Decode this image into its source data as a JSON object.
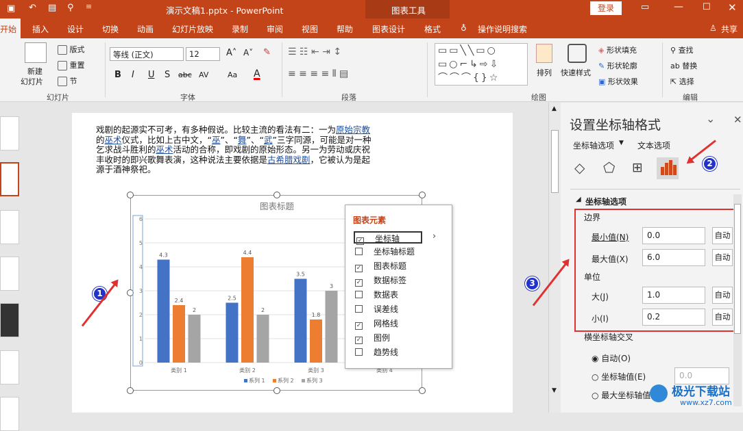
{
  "titlebar": {
    "title": "演示文稿1.pptx - PowerPoint",
    "context_tab": "图表工具",
    "login": "登录"
  },
  "tabs": [
    "开始",
    "插入",
    "设计",
    "切换",
    "动画",
    "幻灯片放映",
    "录制",
    "审阅",
    "视图",
    "帮助",
    "图表设计",
    "格式"
  ],
  "search": "操作说明搜索",
  "share": "共享",
  "ribbon": {
    "new_slide": "新建",
    "new_slide2": "幻灯片",
    "layout": "版式",
    "reset": "重置",
    "section": "节",
    "slides_group": "幻灯片",
    "font_name": "等线 (正文)",
    "font_size": "12",
    "font_group": "字体",
    "para_group": "段落",
    "arrange": "排列",
    "quick_style": "快速样式",
    "fill": "形状填充",
    "outline": "形状轮廓",
    "effects": "形状效果",
    "draw_group": "绘图",
    "find": "查找",
    "replace": "替换",
    "select": "选择",
    "edit_group": "编辑",
    "bold": "B",
    "italic": "I",
    "underline": "U",
    "strike": "S",
    "abc": "abc",
    "av": "AV",
    "aa": "Aa",
    "fontcolor": "A"
  },
  "slide": {
    "p1": "戏剧的起源实不可考，有多种假说。比较主流的看法有二：一为",
    "l1": "原始宗教",
    "p2": "的",
    "l2": "巫术",
    "p3": "仪式，比如上古中文，“",
    "l3": "巫",
    "p4": "”、“",
    "l4": "舞",
    "p5": "”、“",
    "l5": "武",
    "p6": "”三字同源，可能是对一种乞求战斗胜利的",
    "l6": "巫术",
    "p7": "活动的合称，即戏剧的原始形态。另一为劳动或庆祝丰收时的即兴歌舞表演，这种说法主要依据是",
    "l7": "古希腊戏剧",
    "p8": "，它被认为是起源于酒神祭祀。"
  },
  "chart_data": {
    "type": "bar",
    "title": "图表标题",
    "categories": [
      "类别 1",
      "类别 2",
      "类别 3",
      "类别 4"
    ],
    "series": [
      {
        "name": "系列 1",
        "values": [
          4.3,
          2.5,
          3.5,
          null
        ],
        "color": "#4472c4"
      },
      {
        "name": "系列 2",
        "values": [
          2.4,
          4.4,
          1.8,
          null
        ],
        "color": "#ed7d31"
      },
      {
        "name": "系列 3",
        "values": [
          2,
          2,
          3,
          null
        ],
        "color": "#a5a5a5"
      }
    ],
    "ylim": [
      0,
      6
    ],
    "yticks": [
      "0",
      "1",
      "2",
      "3",
      "4",
      "5",
      "6"
    ],
    "grid": true,
    "legend": "bottom"
  },
  "popup": {
    "title": "图表元素",
    "items": [
      {
        "label": "坐标轴",
        "checked": true
      },
      {
        "label": "坐标轴标题",
        "checked": false
      },
      {
        "label": "图表标题",
        "checked": true
      },
      {
        "label": "数据标签",
        "checked": true
      },
      {
        "label": "数据表",
        "checked": false
      },
      {
        "label": "误差线",
        "checked": false
      },
      {
        "label": "网格线",
        "checked": true
      },
      {
        "label": "图例",
        "checked": true
      },
      {
        "label": "趋势线",
        "checked": false
      }
    ]
  },
  "pane": {
    "title": "设置坐标轴格式",
    "tab_axis": "坐标轴选项",
    "tab_text": "文本选项",
    "section": "坐标轴选项",
    "bounds": "边界",
    "min_label": "最小值(N)",
    "min_value": "0.0",
    "max_label": "最大值(X)",
    "max_value": "6.0",
    "units": "单位",
    "major_label": "大(J)",
    "major_value": "1.0",
    "minor_label": "小(I)",
    "minor_value": "0.2",
    "auto": "自动",
    "cross": "横坐标轴交叉",
    "opt_auto": "自动(O)",
    "opt_value": "坐标轴值(E)",
    "opt_value_field": "0.0",
    "opt_max": "最大坐标轴值(M)"
  },
  "annotations": {
    "b1": "1",
    "b2": "2",
    "b3": "3"
  },
  "watermark": {
    "name": "极光下载站",
    "url": "www.xz7.com"
  }
}
